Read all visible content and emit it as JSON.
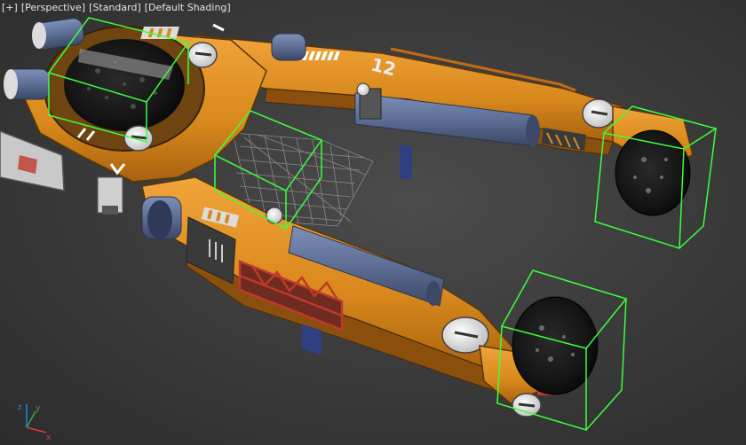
{
  "viewport": {
    "menu": {
      "plus_label": "[+]",
      "view_label": "[Perspective]",
      "shading_label": "[Standard]",
      "mode_label": "[Default Shading]"
    },
    "colors": {
      "background": "#3c3c3c",
      "selection_box": "#3cff3c",
      "grid": "#9a9a9a",
      "hull_orange": "#d98a1e",
      "hull_dark": "#3a3a3a",
      "cylinder_blue": "#5c6e94",
      "wheel_dark": "#151515",
      "bolt_white": "#e6e6e6",
      "warning_red": "#c0392b"
    },
    "model": {
      "hull_number": "12",
      "wheel_count": 4
    },
    "axis_gizmo": {
      "x_label": "x",
      "y_label": "y",
      "z_label": "z"
    }
  }
}
